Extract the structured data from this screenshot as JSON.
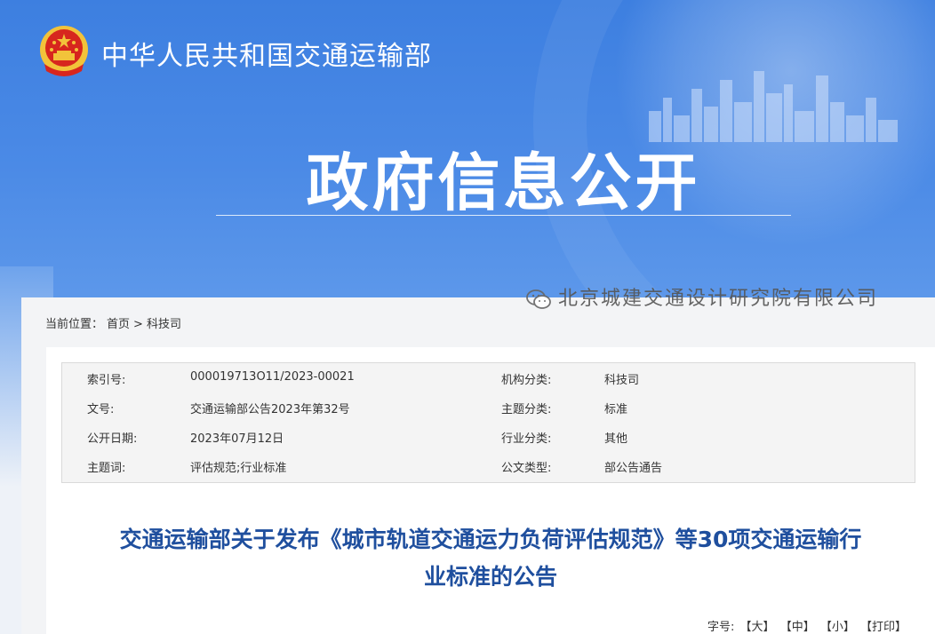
{
  "header": {
    "ministry_name": "中华人民共和国交通运输部",
    "section_title": "政府信息公开"
  },
  "breadcrumb": {
    "label": "当前位置：",
    "home": "首页",
    "separator": ">",
    "current": "科技司"
  },
  "meta": {
    "rows": [
      {
        "k1": "索引号:",
        "v1": "000019713O11/2023-00021",
        "k2": "机构分类:",
        "v2": "科技司"
      },
      {
        "k1": "文号:",
        "v1": "交通运输部公告2023年第32号",
        "k2": "主题分类:",
        "v2": "标准"
      },
      {
        "k1": "公开日期:",
        "v1": "2023年07月12日",
        "k2": "行业分类:",
        "v2": "其他"
      },
      {
        "k1": "主题词:",
        "v1": "评估规范;行业标准",
        "k2": "公文类型:",
        "v2": "部公告通告"
      }
    ]
  },
  "article": {
    "title_line1": "交通运输部关于发布《城市轨道交通运力负荷评估规范》等30项交通运输行",
    "title_line2": "业标准的公告"
  },
  "watermark": {
    "text": "北京城建交通设计研究院有限公司"
  },
  "font_controls": {
    "label": "字号:",
    "large": "【大】",
    "medium": "【中】",
    "small": "【小】",
    "print": "【打印】"
  },
  "colors": {
    "banner_blue": "#4b8ae6",
    "title_blue": "#1f4f9e",
    "emblem_red": "#d7261e",
    "emblem_gold": "#f2c33a"
  }
}
